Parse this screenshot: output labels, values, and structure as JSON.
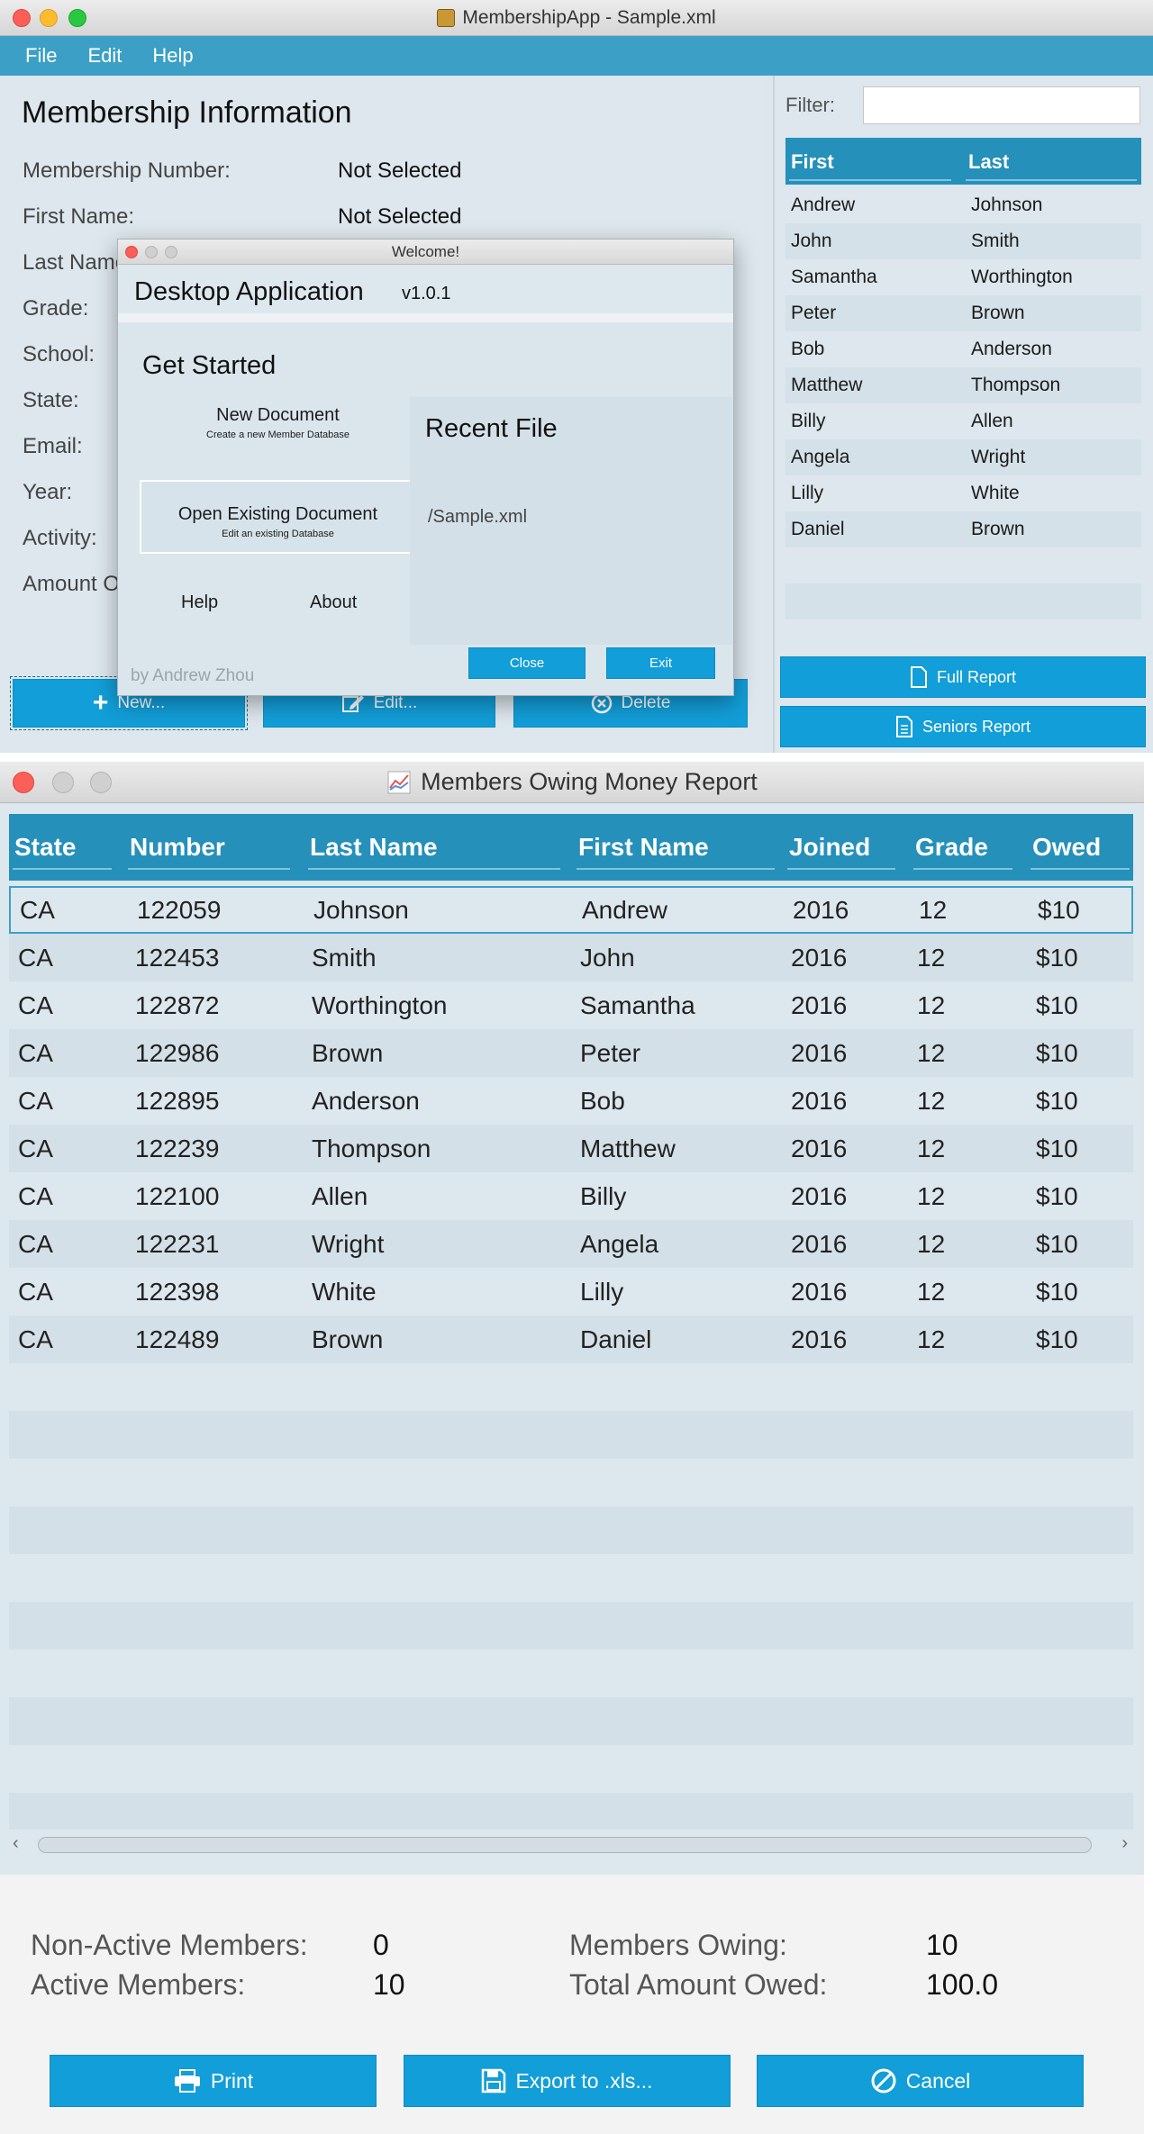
{
  "main_window": {
    "title": "MembershipApp - Sample.xml",
    "menu": [
      "File",
      "Edit",
      "Help"
    ],
    "info_title": "Membership Information",
    "fields": [
      {
        "label": "Membership Number:",
        "value": "Not Selected"
      },
      {
        "label": "First Name:",
        "value": "Not Selected"
      },
      {
        "label": "Last Name:",
        "value": ""
      },
      {
        "label": "Grade:",
        "value": ""
      },
      {
        "label": "School:",
        "value": ""
      },
      {
        "label": "State:",
        "value": ""
      },
      {
        "label": "Email:",
        "value": ""
      },
      {
        "label": "Year:",
        "value": ""
      },
      {
        "label": "Activity:",
        "value": ""
      },
      {
        "label": "Amount Owed:",
        "value": ""
      }
    ],
    "buttons": {
      "new": "New...",
      "edit": "Edit...",
      "delete": "Delete"
    },
    "filter_label": "Filter:",
    "filter_value": "",
    "list_headers": {
      "first": "First",
      "last": "Last"
    },
    "list": [
      {
        "first": "Andrew",
        "last": "Johnson"
      },
      {
        "first": "John",
        "last": "Smith"
      },
      {
        "first": "Samantha",
        "last": "Worthington"
      },
      {
        "first": "Peter",
        "last": "Brown"
      },
      {
        "first": "Bob",
        "last": "Anderson"
      },
      {
        "first": "Matthew",
        "last": "Thompson"
      },
      {
        "first": "Billy",
        "last": "Allen"
      },
      {
        "first": "Angela",
        "last": "Wright"
      },
      {
        "first": "Lilly",
        "last": "White"
      },
      {
        "first": "Daniel",
        "last": "Brown"
      }
    ],
    "report_buttons": {
      "full": "Full Report",
      "seniors": "Seniors Report"
    }
  },
  "welcome": {
    "title": "Welcome!",
    "app_name": "Desktop Application",
    "version": "v1.0.1",
    "get_started": "Get Started",
    "new_doc": "New Document",
    "new_doc_sub": "Create a new Member Database",
    "open_doc": "Open Existing Document",
    "open_doc_sub": "Edit an existing Database",
    "help": "Help",
    "about": "About",
    "recent_title": "Recent File",
    "recent_file": "/Sample.xml",
    "author": "by Andrew Zhou",
    "close": "Close",
    "exit": "Exit"
  },
  "report": {
    "title": "Members Owing Money Report",
    "columns": [
      "State",
      "Number",
      "Last Name",
      "First Name",
      "Joined",
      "Grade",
      "Owed"
    ],
    "rows": [
      [
        "CA",
        "122059",
        "Johnson",
        "Andrew",
        "2016",
        "12",
        "$10"
      ],
      [
        "CA",
        "122453",
        "Smith",
        "John",
        "2016",
        "12",
        "$10"
      ],
      [
        "CA",
        "122872",
        "Worthington",
        "Samantha",
        "2016",
        "12",
        "$10"
      ],
      [
        "CA",
        "122986",
        "Brown",
        "Peter",
        "2016",
        "12",
        "$10"
      ],
      [
        "CA",
        "122895",
        "Anderson",
        "Bob",
        "2016",
        "12",
        "$10"
      ],
      [
        "CA",
        "122239",
        "Thompson",
        "Matthew",
        "2016",
        "12",
        "$10"
      ],
      [
        "CA",
        "122100",
        "Allen",
        "Billy",
        "2016",
        "12",
        "$10"
      ],
      [
        "CA",
        "122231",
        "Wright",
        "Angela",
        "2016",
        "12",
        "$10"
      ],
      [
        "CA",
        "122398",
        "White",
        "Lilly",
        "2016",
        "12",
        "$10"
      ],
      [
        "CA",
        "122489",
        "Brown",
        "Daniel",
        "2016",
        "12",
        "$10"
      ]
    ],
    "summary": {
      "non_active_label": "Non-Active Members:",
      "non_active": "0",
      "active_label": "Active Members:",
      "active": "10",
      "owing_label": "Members Owing:",
      "owing": "10",
      "total_label": "Total Amount Owed:",
      "total": "100.0"
    },
    "buttons": {
      "print": "Print",
      "export": "Export to .xls...",
      "cancel": "Cancel"
    }
  },
  "colors": {
    "accent": "#129ed8",
    "menubar": "#3ca0c6",
    "header": "#2590ba",
    "panel": "#dde7ed"
  }
}
